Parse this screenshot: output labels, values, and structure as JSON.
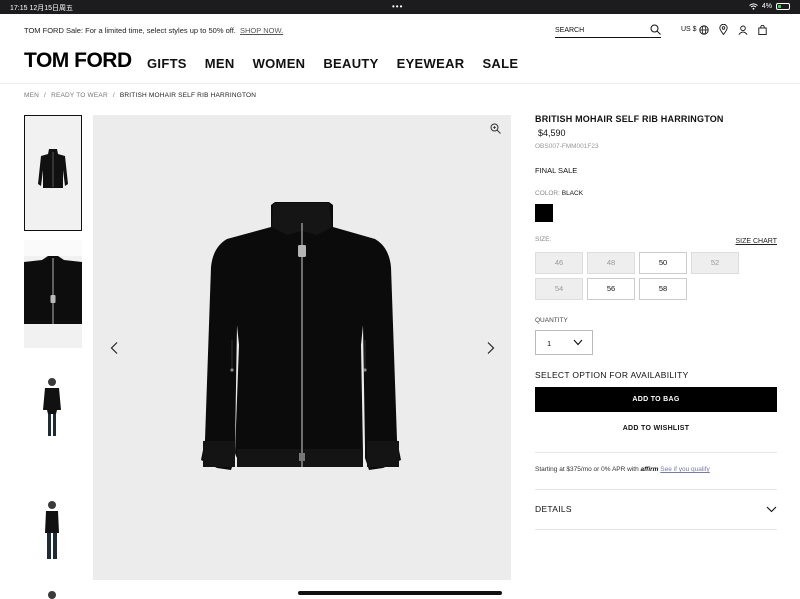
{
  "status_bar": {
    "time": "17:15",
    "date": "12月15日周五",
    "battery": "4%",
    "dots": "•••"
  },
  "promo": {
    "text": "TOM FORD Sale: For a limited time, select styles up to 50% off.",
    "link": "SHOP NOW."
  },
  "search": {
    "label": "SEARCH",
    "icon": "search-icon"
  },
  "utility": {
    "currency": "US $",
    "icons": [
      "globe-icon",
      "location-pin-icon",
      "account-icon",
      "shopping-bag-icon"
    ]
  },
  "brand": {
    "logo": "TOM FORD"
  },
  "nav": {
    "items": [
      "GIFTS",
      "MEN",
      "WOMEN",
      "BEAUTY",
      "EYEWEAR",
      "SALE"
    ]
  },
  "breadcrumb": {
    "items": [
      "MEN",
      "READY TO WEAR",
      "BRITISH MOHAIR SELF RIB HARRINGTON"
    ],
    "separator": "/"
  },
  "gallery": {
    "thumbnails": [
      "jacket-front-thumbnail",
      "jacket-zipper-detail-thumbnail",
      "model-front-thumbnail",
      "model-side-thumbnail",
      "model-partial-thumbnail"
    ],
    "main_image": "black-harrington-jacket-image"
  },
  "product": {
    "name": "BRITISH MOHAIR SELF RIB HARRINGTON",
    "price": "$4,590",
    "sku": "OBS007-FMM001F23",
    "final_sale": "FINAL SALE",
    "color_label": "COLOR:",
    "color_value": "BLACK",
    "swatch_color": "#000000",
    "size_label": "SIZE:",
    "size_chart": "SIZE CHART",
    "sizes": [
      {
        "label": "46",
        "available": false
      },
      {
        "label": "48",
        "available": false
      },
      {
        "label": "50",
        "available": true
      },
      {
        "label": "52",
        "available": false
      },
      {
        "label": "54",
        "available": false
      },
      {
        "label": "56",
        "available": true
      },
      {
        "label": "58",
        "available": true
      }
    ],
    "quantity_label": "QUANTITY",
    "quantity_value": "1",
    "select_option": "SELECT OPTION FOR AVAILABILITY",
    "add_to_bag": "ADD TO BAG",
    "add_to_wishlist": "ADD TO WISHLIST",
    "affirm_text": "Starting at $375/mo or 0% APR with",
    "affirm_brand": "affirm",
    "affirm_link": "See if you qualify",
    "details": "DETAILS"
  }
}
